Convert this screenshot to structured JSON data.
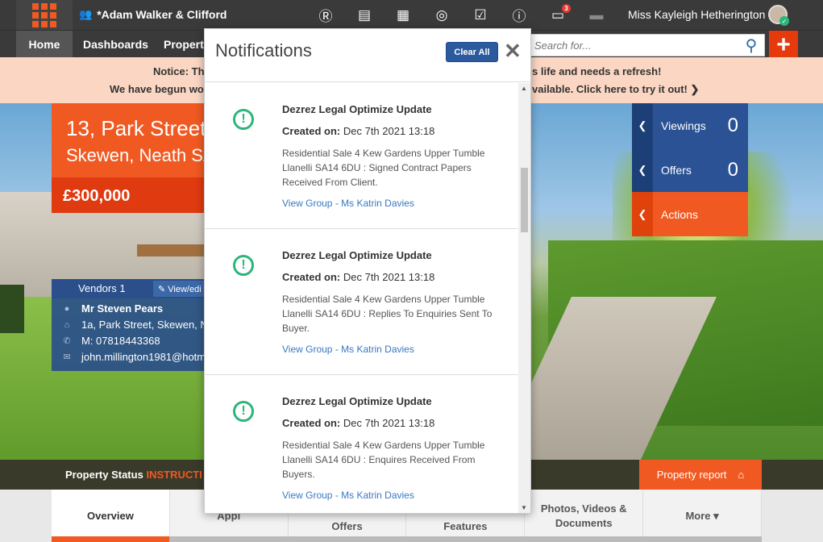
{
  "topbar": {
    "company": "*Adam Walker & Clifford",
    "username": "Miss Kayleigh Hetherington",
    "icons": [
      {
        "name": "r-icon",
        "glyph": "Ⓡ"
      },
      {
        "name": "chart-icon",
        "glyph": "▤"
      },
      {
        "name": "calendar-icon",
        "glyph": "▦"
      },
      {
        "name": "target-icon",
        "glyph": "◎"
      },
      {
        "name": "checkbox-icon",
        "glyph": "☑"
      },
      {
        "name": "alert-icon",
        "glyph": "ⓘ"
      },
      {
        "name": "chat-icon",
        "glyph": "▭",
        "badge": "3"
      },
      {
        "name": "printer-icon",
        "glyph": "▬"
      }
    ]
  },
  "nav": {
    "home": "Home",
    "dashboards": "Dashboards",
    "properties": "Properti",
    "search_placeholder": "Search for..."
  },
  "notice": {
    "line1_left": "Notice: Th",
    "line1_right": "s life and needs a refresh!",
    "line2_left": "We have begun wo",
    "line2_right": "vailable. Click here to try it out! ❯"
  },
  "property": {
    "address1": "13, Park Street",
    "address2": "Skewen, Neath SA",
    "price": "£300,000"
  },
  "vendors": {
    "header": "Vendors 1",
    "edit_label": "View/edi",
    "name": "Mr Steven Pears",
    "address": "1a, Park Street, Skewen, Ne",
    "mobile": "M: 07818443368",
    "email": "john.millington1981@hotm"
  },
  "side_panel": {
    "viewings_label": "Viewings",
    "viewings_count": "0",
    "offers_label": "Offers",
    "offers_count": "0",
    "actions_label": "Actions"
  },
  "status": {
    "label": "Property Status",
    "value": "INSTRUCTI",
    "report_button": "Property report"
  },
  "tabs": [
    "Overview",
    "Appl",
    "Offers",
    "Features",
    "Photos, Videos & Documents",
    "More ▾"
  ],
  "notifications": {
    "title": "Notifications",
    "clear_all": "Clear All",
    "items": [
      {
        "title": "Dezrez Legal Optimize Update",
        "created_label": "Created on:",
        "created_value": "Dec 7th 2021 13:18",
        "body": "Residential Sale 4 Kew Gardens Upper Tumble  Llanelli SA14 6DU : Signed Contract Papers Received From Client.",
        "link": "View Group - Ms Katrin Davies"
      },
      {
        "title": "Dezrez Legal Optimize Update",
        "created_label": "Created on:",
        "created_value": "Dec 7th 2021 13:18",
        "body": "Residential Sale 4 Kew Gardens Upper Tumble  Llanelli SA14 6DU : Replies To Enquiries Sent To Buyer.",
        "link": "View Group - Ms Katrin Davies"
      },
      {
        "title": "Dezrez Legal Optimize Update",
        "created_label": "Created on:",
        "created_value": "Dec 7th 2021 13:18",
        "body": "Residential Sale 4 Kew Gardens Upper Tumble  Llanelli SA14 6DU : Enquires Received From Buyers.",
        "link": "View Group - Ms Katrin Davies"
      }
    ]
  },
  "colors": {
    "accent_orange": "#f05a22",
    "brand_blue": "#2a5294",
    "success_green": "#2db57b",
    "link_blue": "#3a78c2"
  }
}
